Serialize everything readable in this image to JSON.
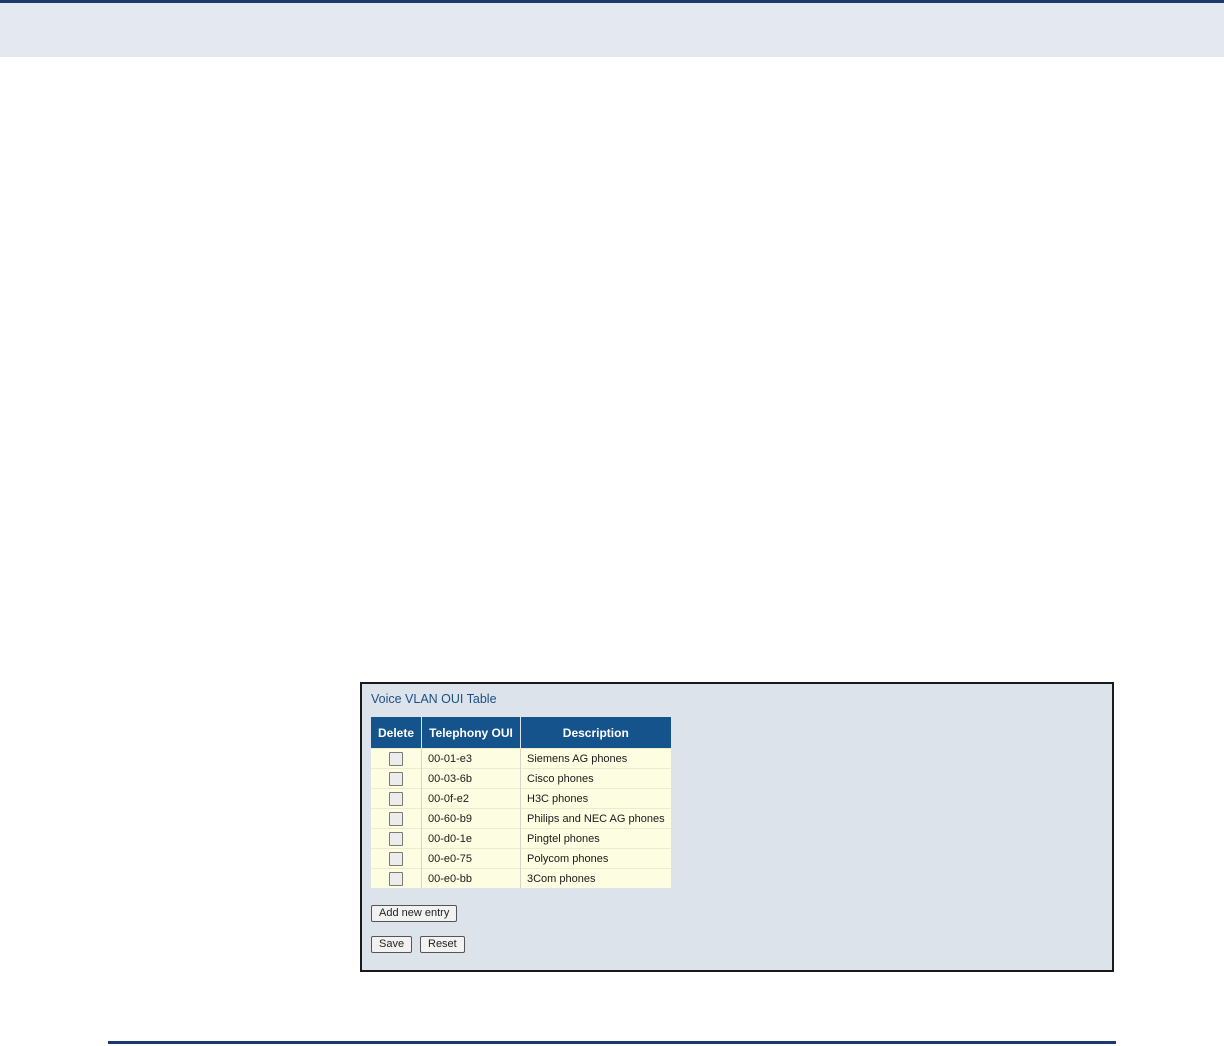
{
  "panel": {
    "title": "Voice VLAN OUI Table"
  },
  "table": {
    "headers": {
      "delete": "Delete",
      "oui": "Telephony OUI",
      "description": "Description"
    },
    "rows": [
      {
        "oui": "00-01-e3",
        "description": "Siemens AG phones",
        "checked": false
      },
      {
        "oui": "00-03-6b",
        "description": "Cisco phones",
        "checked": false
      },
      {
        "oui": "00-0f-e2",
        "description": "H3C phones",
        "checked": false
      },
      {
        "oui": "00-60-b9",
        "description": "Philips and NEC AG phones",
        "checked": false
      },
      {
        "oui": "00-d0-1e",
        "description": "Pingtel phones",
        "checked": false
      },
      {
        "oui": "00-e0-75",
        "description": "Polycom phones",
        "checked": false
      },
      {
        "oui": "00-e0-bb",
        "description": "3Com phones",
        "checked": false
      }
    ]
  },
  "buttons": {
    "add_label": "Add new entry",
    "save_label": "Save",
    "reset_label": "Reset"
  },
  "colors": {
    "header_bg": "#15538c",
    "row_bg": "#fdfde1",
    "panel_bg": "#dce3eb",
    "title": "#1b4f86",
    "rule": "#1b3a6b"
  }
}
